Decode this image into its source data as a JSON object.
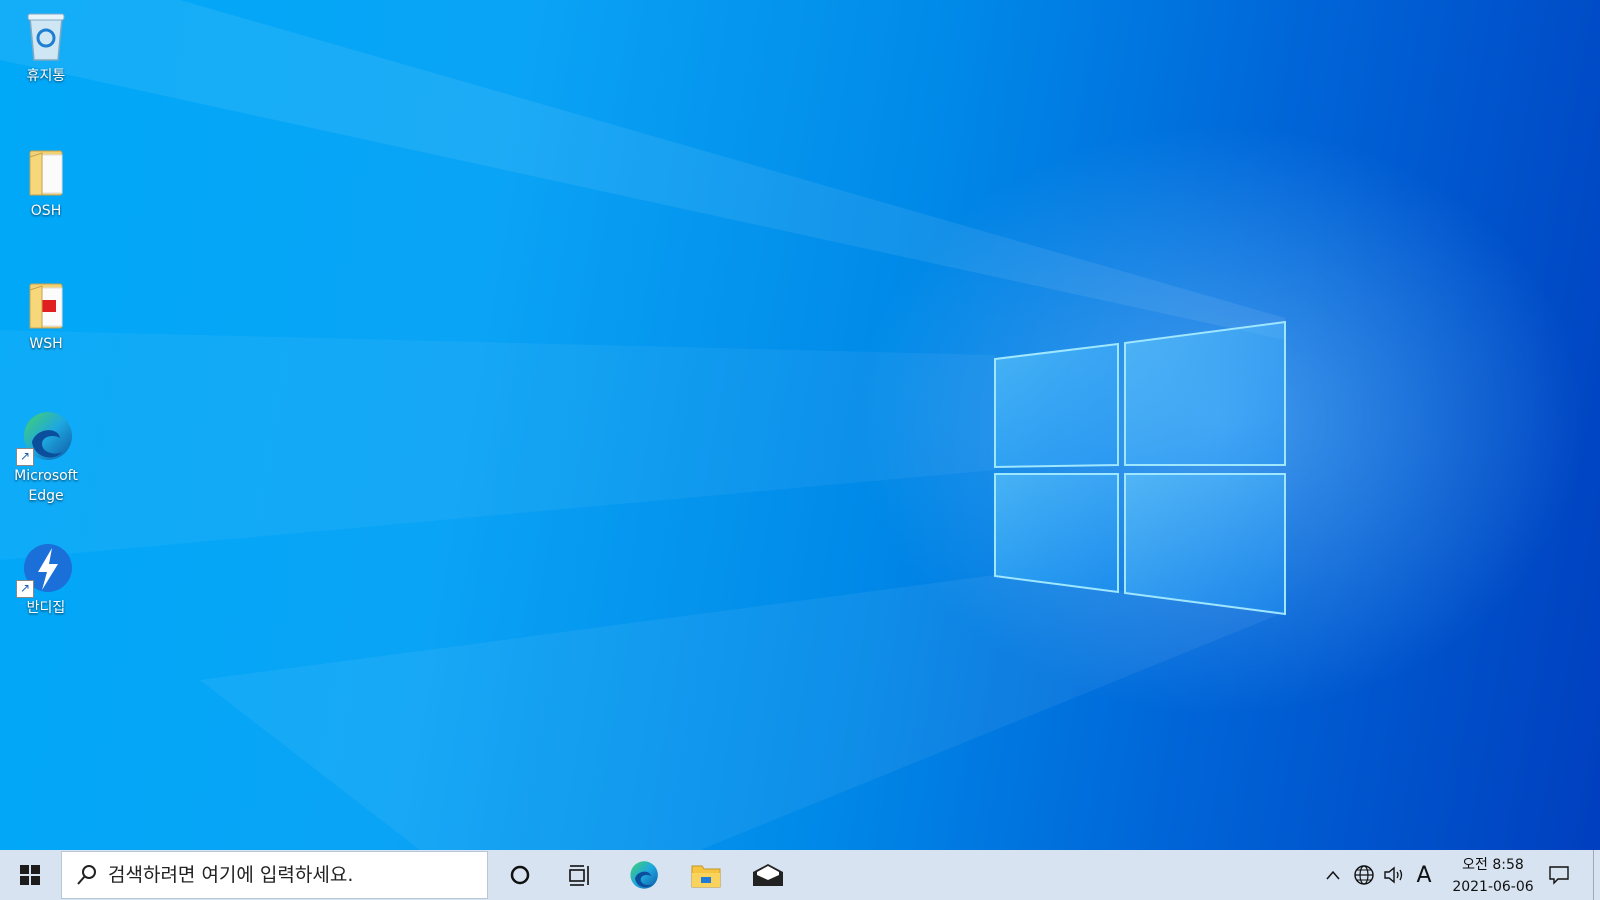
{
  "desktop": {
    "icons": [
      {
        "label": "휴지통",
        "icon": "recycle-bin-icon"
      },
      {
        "label": "OSH",
        "icon": "folder-icon"
      },
      {
        "label": "WSH",
        "icon": "pdf-folder-icon"
      },
      {
        "label": "Microsoft\nEdge",
        "icon": "edge-icon",
        "shortcut": true
      },
      {
        "label": "반디집",
        "icon": "bandizip-icon",
        "shortcut": true
      }
    ]
  },
  "taskbar": {
    "search_placeholder": "검색하려면 여기에 입력하세요.",
    "pinned": [
      "cortana-icon",
      "task-view-icon",
      "edge-icon",
      "file-explorer-icon",
      "mail-icon"
    ],
    "tray": {
      "ime_indicator": "A",
      "time": "오전 8:58",
      "date": "2021-06-06"
    }
  },
  "colors": {
    "desktop_light": "#00a8f8",
    "desktop_dark": "#003fbf",
    "taskbar": "#d7e3f1"
  }
}
